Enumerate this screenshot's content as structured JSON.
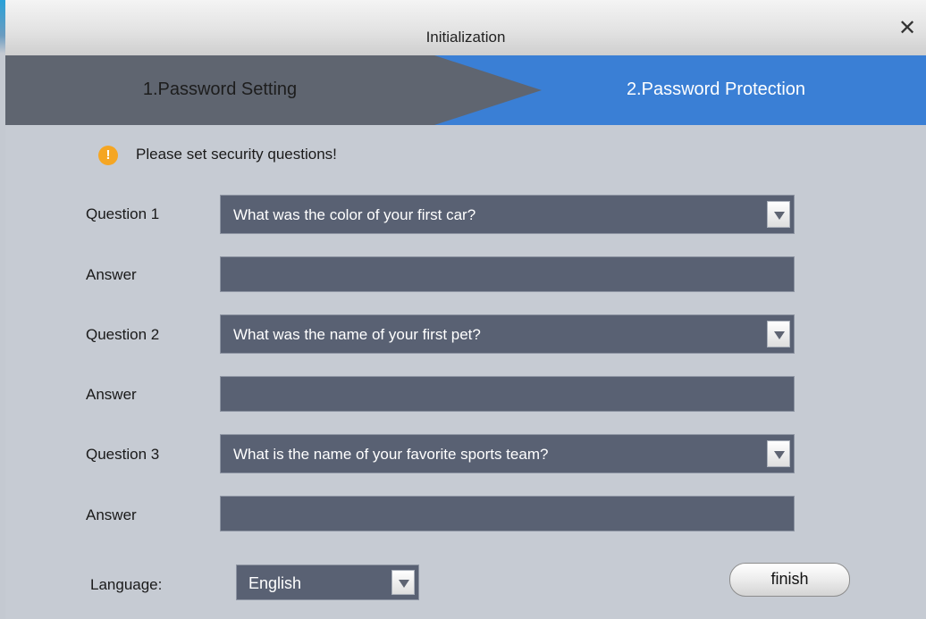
{
  "window": {
    "title": "Initialization",
    "close_glyph": "✕"
  },
  "steps": [
    {
      "label": "1.Password Setting",
      "active": false,
      "color": "#5f6570"
    },
    {
      "label": "2.Password Protection",
      "active": true,
      "color": "#3a7fd5"
    }
  ],
  "notice": {
    "icon": "warning-icon",
    "icon_glyph": "!",
    "text": "Please set security questions!",
    "icon_color": "#f5a623"
  },
  "questions": [
    {
      "label": "Question 1",
      "selected": "What was the color of your first car?",
      "answer_label": "Answer",
      "answer_value": ""
    },
    {
      "label": "Question 2",
      "selected": "What was the name of your first pet?",
      "answer_label": "Answer",
      "answer_value": ""
    },
    {
      "label": "Question 3",
      "selected": "What is the name of your favorite sports team?",
      "answer_label": "Answer",
      "answer_value": ""
    }
  ],
  "language": {
    "label": "Language:",
    "selected": "English"
  },
  "finish_label": "finish",
  "colors": {
    "field_bg": "#596173",
    "panel_bg": "#c6cbd3"
  }
}
